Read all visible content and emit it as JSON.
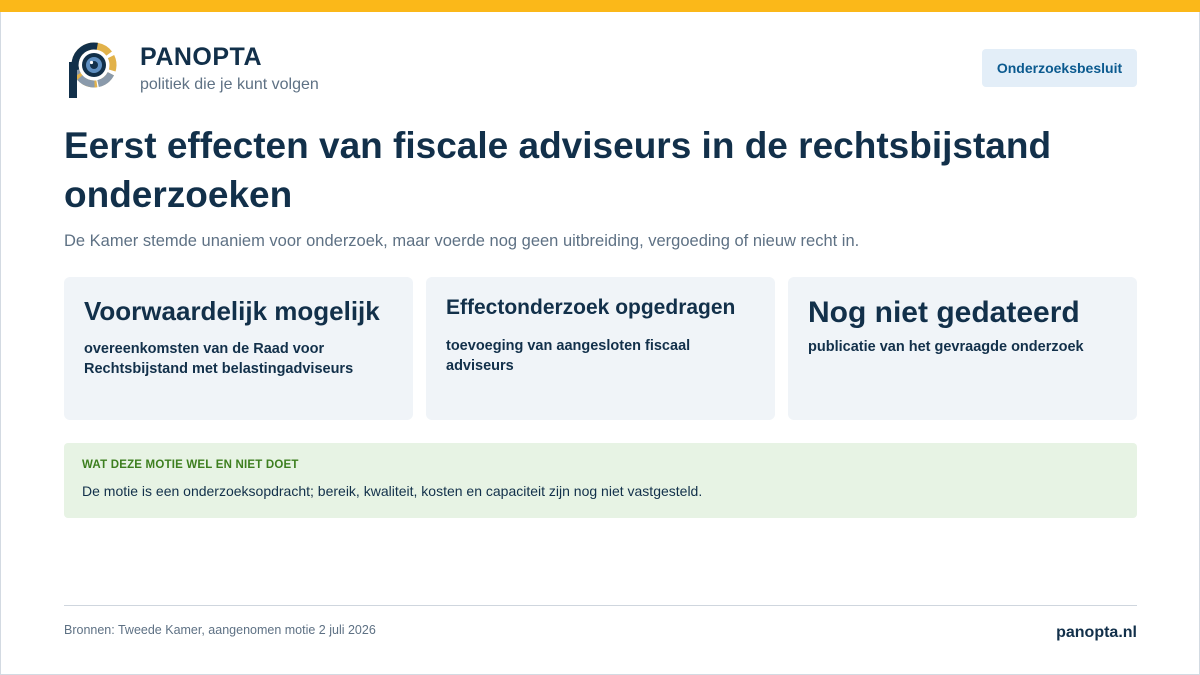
{
  "brand": {
    "name": "PANOPTA",
    "tagline": "politiek die je kunt volgen",
    "logo_icon": "eye-p-logo-icon",
    "colors": {
      "navy": "#12304a",
      "gold": "#e2b24a",
      "blue": "#5f8fc1",
      "slate": "#8a9aab"
    }
  },
  "badge": {
    "label": "Onderzoeksbesluit"
  },
  "headline": {
    "title": "Eerst effecten van fiscale adviseurs in de rechtsbijstand onderzoeken",
    "subtitle": "De Kamer stemde unaniem voor onderzoek, maar voerde nog geen uitbreiding, vergoeding of nieuw recht in."
  },
  "cards": [
    {
      "heading": "Voorwaardelijk mogelijk",
      "text": "overeenkomsten van de Raad voor Rechtsbijstand met belastingadviseurs"
    },
    {
      "heading": "Effectonderzoek opgedragen",
      "text": "toevoeging van aangesloten fiscaal adviseurs"
    },
    {
      "heading": "Nog niet gedateerd",
      "text": "publicatie van het gevraagde onderzoek"
    }
  ],
  "note": {
    "heading": "WAT DEZE MOTIE WEL EN NIET DOET",
    "text": "De motie is een onderzoeksopdracht; bereik, kwaliteit, kosten en capaciteit zijn nog niet vastgesteld."
  },
  "footer": {
    "sources": "Bronnen: Tweede Kamer, aangenomen motie 2 juli 2026",
    "site": "panopta.nl"
  },
  "theme": {
    "accent_bar": "#fbb819",
    "badge_bg": "#e3eef8",
    "note_bg": "#e7f3e4",
    "card_bg": "#f0f4f8"
  }
}
